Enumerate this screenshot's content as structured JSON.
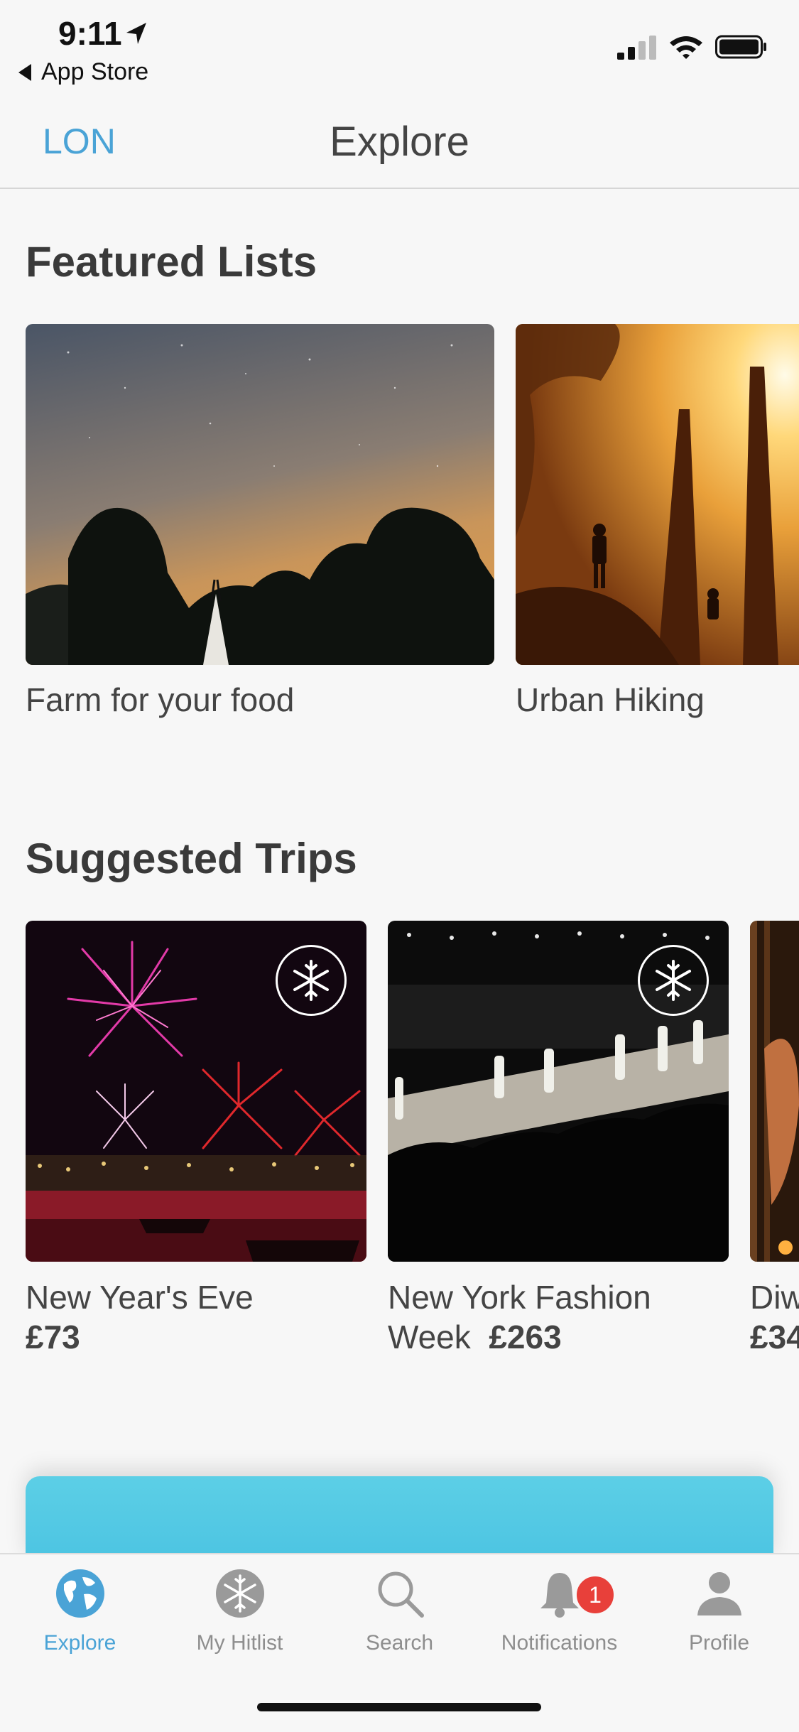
{
  "status": {
    "time": "9:11",
    "back_app": "App Store"
  },
  "nav": {
    "left_label": "LON",
    "title": "Explore"
  },
  "featured": {
    "title": "Featured Lists",
    "cards": [
      {
        "caption": "Farm for your food"
      },
      {
        "caption": "Urban Hiking"
      }
    ]
  },
  "suggested": {
    "title": "Suggested Trips",
    "cards": [
      {
        "name": "New Year's Eve",
        "price": "£73"
      },
      {
        "name_line1": "New York Fashion",
        "name_line2": "Week",
        "price": "£263"
      },
      {
        "name": "Diw",
        "price": "£34"
      }
    ]
  },
  "tabs": [
    {
      "label": "Explore",
      "icon": "globe-icon",
      "active": true
    },
    {
      "label": "My Hitlist",
      "icon": "snowflake-plane-icon"
    },
    {
      "label": "Search",
      "icon": "search-icon"
    },
    {
      "label": "Notifications",
      "icon": "bell-icon",
      "badge": "1"
    },
    {
      "label": "Profile",
      "icon": "person-icon"
    }
  ],
  "colors": {
    "accent": "#4aa3d6",
    "badge": "#e8403a",
    "promo": "#5ccfe6"
  }
}
